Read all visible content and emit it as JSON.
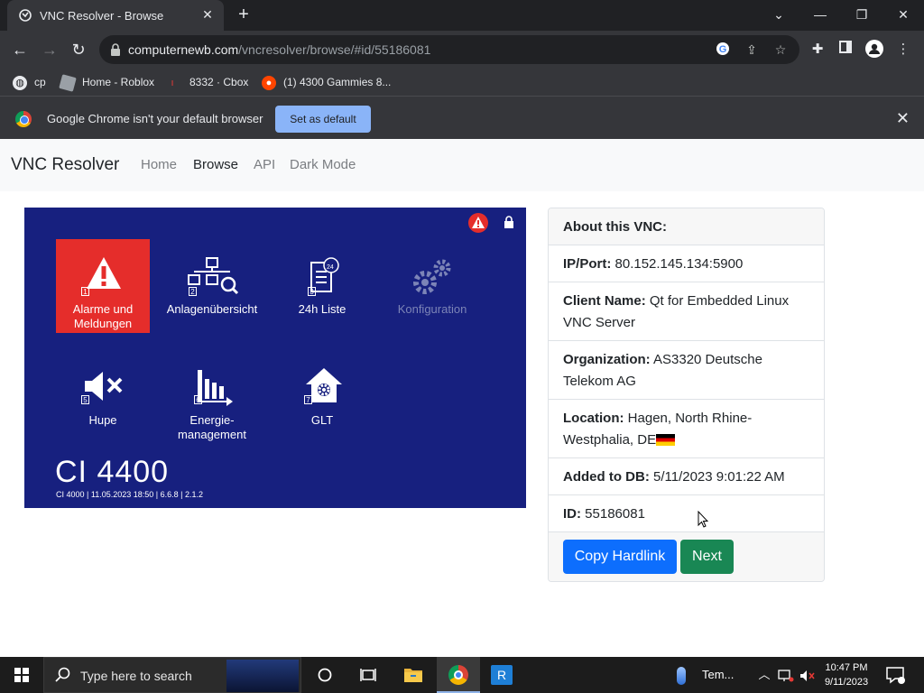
{
  "browser": {
    "tab_title": "VNC Resolver - Browse",
    "url_domain": "computernewb.com",
    "url_path": "/vncresolver/browse/#id/55186081",
    "bookmarks": [
      {
        "label": "cp"
      },
      {
        "label": "Home - Roblox"
      },
      {
        "label": "8332 · Cbox"
      },
      {
        "label": "(1) 4300 Gammies 8..."
      }
    ],
    "infobar": {
      "message": "Google Chrome isn't your default browser",
      "button": "Set as default"
    }
  },
  "site": {
    "brand": "VNC Resolver",
    "nav": [
      {
        "label": "Home"
      },
      {
        "label": "Browse"
      },
      {
        "label": "API"
      },
      {
        "label": "Dark Mode"
      }
    ]
  },
  "screenshot": {
    "tiles": [
      {
        "num": "1",
        "label_line1": "Alarme und",
        "label_line2": "Meldungen"
      },
      {
        "num": "2",
        "label_line1": "Anlagenübersicht",
        "label_line2": ""
      },
      {
        "num": "3",
        "label_line1": "24h Liste",
        "label_line2": ""
      },
      {
        "num": "",
        "label_line1": "Konfiguration",
        "label_line2": ""
      },
      {
        "num": "5",
        "label_line1": "Hupe",
        "label_line2": ""
      },
      {
        "num": "6",
        "label_line1": "Energie-",
        "label_line2": "management"
      },
      {
        "num": "7",
        "label_line1": "GLT",
        "label_line2": ""
      }
    ],
    "clock_badge": "24",
    "device_title": "CI 4400",
    "device_subtitle": "CI 4000 | 11.05.2023 18:50 | 6.6.8 | 2.1.2"
  },
  "info_card": {
    "header": "About this VNC:",
    "ip_label": "IP/Port:",
    "ip_value": "80.152.145.134:5900",
    "client_label": "Client Name:",
    "client_value": "Qt for Embedded Linux VNC Server",
    "org_label": "Organization:",
    "org_value": "AS3320 Deutsche Telekom AG",
    "location_label": "Location:",
    "location_value": "Hagen, North Rhine-Westphalia, DE",
    "added_label": "Added to DB:",
    "added_value": "5/11/2023 9:01:22 AM",
    "id_label": "ID:",
    "id_value": "55186081",
    "copy_button": "Copy Hardlink",
    "next_button": "Next"
  },
  "taskbar": {
    "search_placeholder": "Type here to search",
    "weather_label": "Tem...",
    "time": "10:47 PM",
    "date": "9/11/2023"
  }
}
